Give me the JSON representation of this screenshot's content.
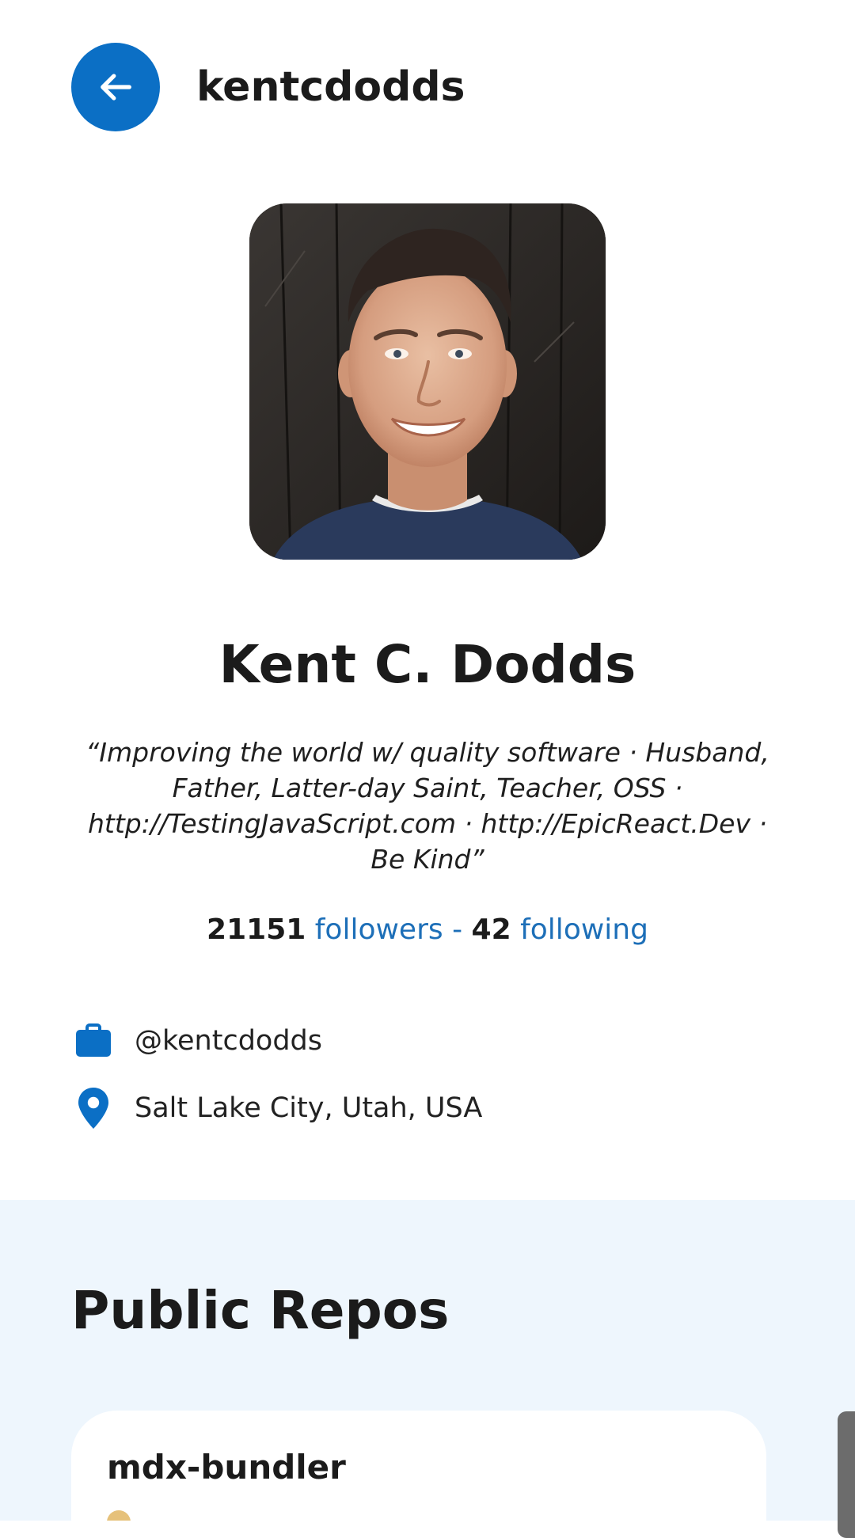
{
  "header": {
    "title": "kentcdodds",
    "back_icon": "arrow-left-icon",
    "accent_color": "#0b6fc5"
  },
  "profile": {
    "name": "Kent C. Dodds",
    "bio": "“Improving the world w/ quality software · Husband, Father, Latter-day Saint, Teacher, OSS · http://TestingJavaScript.com · http://EpicReact.Dev · Be Kind”",
    "followers_count": "21151",
    "followers_label": "followers",
    "separator": "-",
    "following_count": "42",
    "following_label": "following",
    "company": "@kentcdodds",
    "company_icon": "briefcase-icon",
    "location": "Salt Lake City, Utah, USA",
    "location_icon": "map-pin-icon"
  },
  "repos": {
    "title": "Public Repos",
    "items": [
      {
        "name": "mdx-bundler"
      }
    ]
  }
}
